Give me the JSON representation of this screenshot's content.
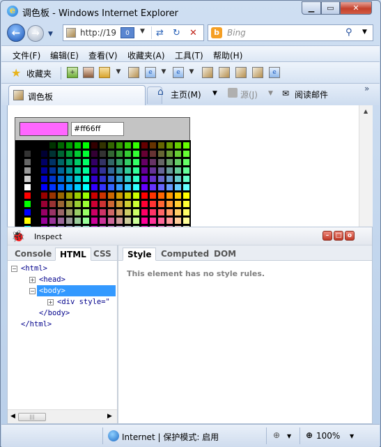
{
  "window": {
    "title": "调色板 - Windows Internet Explorer",
    "minimize": "▁",
    "maximize": "▭",
    "close": "✕"
  },
  "nav": {
    "address": "http://19",
    "compat_badge": "0",
    "search_placeholder": "Bing"
  },
  "menu": [
    "文件(F)",
    "编辑(E)",
    "查看(V)",
    "收藏夹(A)",
    "工具(T)",
    "帮助(H)"
  ],
  "favorites": {
    "label": "收藏夹"
  },
  "tab": {
    "label": "调色板"
  },
  "command_bar": {
    "home": "主页(M)",
    "feeds": "源(J)",
    "read_mail": "阅读邮件",
    "more": "»"
  },
  "palette": {
    "hex_value": "#ff66ff",
    "swatch_color": "#ff66ff"
  },
  "devtools": {
    "title": "Inspect",
    "left_tabs": [
      "Console",
      "HTML",
      "CSS"
    ],
    "left_active": "HTML",
    "right_tabs": [
      "Style",
      "Computed",
      "DOM"
    ],
    "right_active": "Style",
    "tree": [
      {
        "text": "<html>",
        "toggle": "−"
      },
      {
        "text": "<head>",
        "toggle": "+"
      },
      {
        "text": "<body>",
        "toggle": "−",
        "selected": true
      },
      {
        "text": "<div style=\"",
        "toggle": "+"
      },
      {
        "text": "</body>"
      },
      {
        "text": "</html>"
      }
    ],
    "style_message": "This element has no style rules."
  },
  "status": {
    "zone": "Internet | 保护模式: 启用",
    "zoom": "100%"
  }
}
